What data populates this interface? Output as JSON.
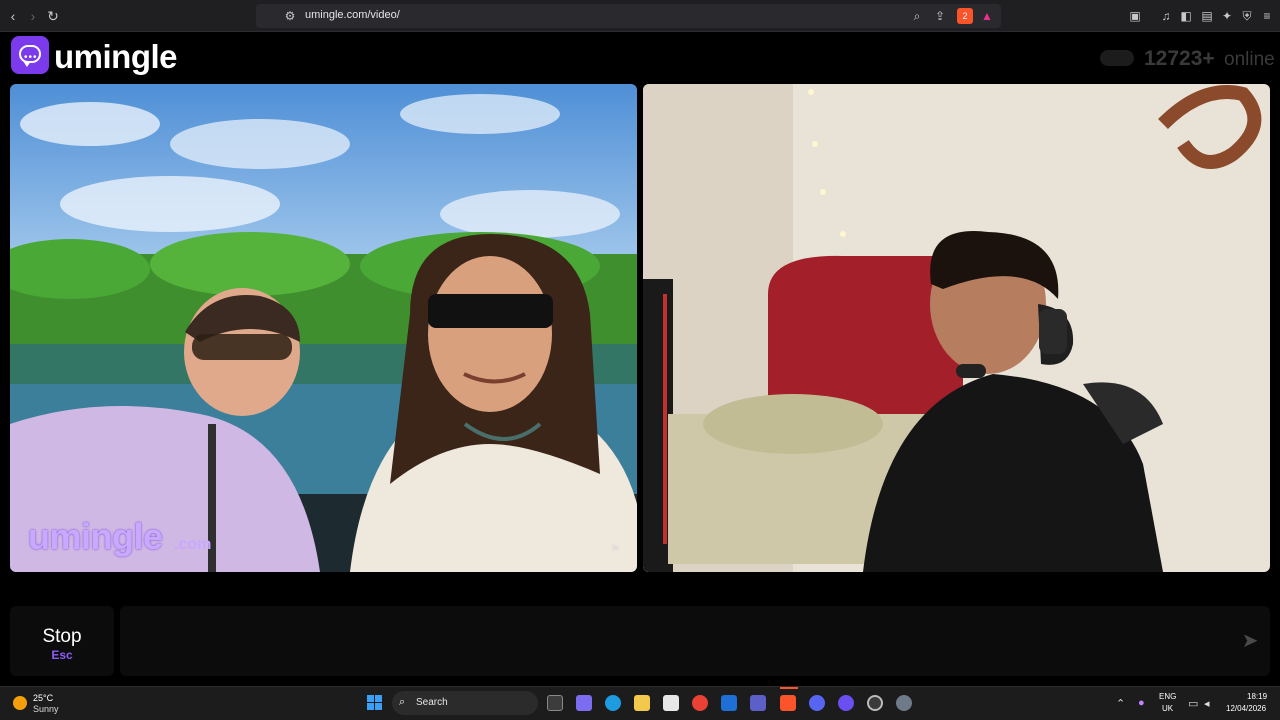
{
  "browser": {
    "url": "umingle.com/video/",
    "brave_badge": "2"
  },
  "header": {
    "logo_text": "umingle",
    "online_count": "12723+",
    "online_label": "online"
  },
  "video_left": {
    "watermark_main": "umingle",
    "watermark_suffix": ".com"
  },
  "controls": {
    "stop_label": "Stop",
    "stop_shortcut": "Esc",
    "chat_value": ""
  },
  "taskbar": {
    "weather_temp": "25°C",
    "weather_condition": "Sunny",
    "search_label": "Search",
    "language_line1": "ENG",
    "language_line2": "UK",
    "time": "18:19",
    "date": "12/04/2026"
  },
  "colors": {
    "brand": "#7c3aed",
    "accent_esc": "#8b5cf6",
    "brave": "#fb542b"
  }
}
